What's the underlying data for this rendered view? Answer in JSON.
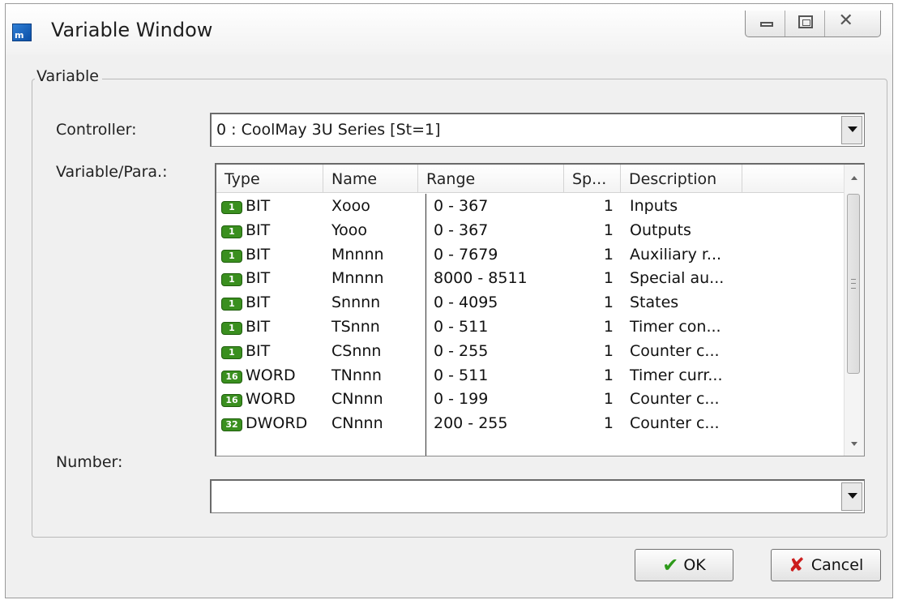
{
  "window": {
    "title": "Variable Window",
    "app_icon_letter": "m"
  },
  "group": {
    "label": "Variable"
  },
  "controller": {
    "label": "Controller:",
    "value": "0 : CoolMay 3U Series [St=1]"
  },
  "variable": {
    "label": "Variable/Para.:",
    "columns": [
      "Type",
      "Name",
      "Range",
      "Sp...",
      "Description"
    ],
    "rows": [
      {
        "badge": "1",
        "type": "BIT",
        "name": "Xooo",
        "range": "0 - 367",
        "sp": "1",
        "desc": "Inputs"
      },
      {
        "badge": "1",
        "type": "BIT",
        "name": "Yooo",
        "range": "0 - 367",
        "sp": "1",
        "desc": "Outputs"
      },
      {
        "badge": "1",
        "type": "BIT",
        "name": "Mnnnn",
        "range": "0 - 7679",
        "sp": "1",
        "desc": "Auxiliary r..."
      },
      {
        "badge": "1",
        "type": "BIT",
        "name": "Mnnnn",
        "range": "8000 - 8511",
        "sp": "1",
        "desc": "Special au..."
      },
      {
        "badge": "1",
        "type": "BIT",
        "name": "Snnnn",
        "range": "0 - 4095",
        "sp": "1",
        "desc": "States"
      },
      {
        "badge": "1",
        "type": "BIT",
        "name": "TSnnn",
        "range": "0 - 511",
        "sp": "1",
        "desc": "Timer con..."
      },
      {
        "badge": "1",
        "type": "BIT",
        "name": "CSnnn",
        "range": "0 - 255",
        "sp": "1",
        "desc": "Counter c..."
      },
      {
        "badge": "16",
        "type": "WORD",
        "name": "TNnnn",
        "range": "0 - 511",
        "sp": "1",
        "desc": "Timer curr..."
      },
      {
        "badge": "16",
        "type": "WORD",
        "name": "CNnnn",
        "range": "0 - 199",
        "sp": "1",
        "desc": "Counter c..."
      },
      {
        "badge": "32",
        "type": "DWORD",
        "name": "CNnnn",
        "range": "200 - 255",
        "sp": "1",
        "desc": "Counter c..."
      }
    ]
  },
  "number": {
    "label": "Number:",
    "value": ""
  },
  "buttons": {
    "ok": "OK",
    "cancel": "Cancel"
  },
  "colors": {
    "badge_green": "#3a8f1f",
    "ok_check": "#2d9a1a",
    "cancel_x": "#cc1c1c"
  }
}
